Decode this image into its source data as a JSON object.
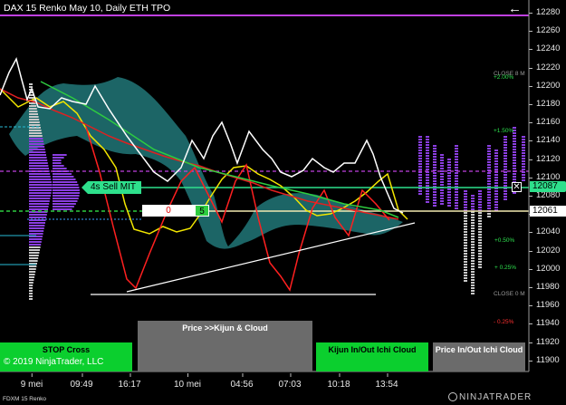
{
  "title": "DAX 15 Renko May 10, Daily ETH TPO",
  "price_axis": [
    "12280",
    "12260",
    "12240",
    "12220",
    "12200",
    "12180",
    "12160",
    "12140",
    "12120",
    "12100",
    "12080",
    "12060",
    "12040",
    "12020",
    "12000",
    "11980",
    "11960",
    "11940",
    "11920",
    "11900"
  ],
  "price_tags": {
    "sell_price": "12087",
    "last_price": "12061"
  },
  "time_axis": [
    "9 mei",
    "09:49",
    "16:17",
    "10 mei",
    "04:56",
    "07:03",
    "10:18",
    "13:54"
  ],
  "pct_levels": [
    {
      "text": "CLOSE 8 M",
      "color": "#9a9a9a"
    },
    {
      "text": "+2.00%",
      "color": "#2ee04e"
    },
    {
      "text": "+1.50%",
      "color": "#2ee04e"
    },
    {
      "text": "+0.50%",
      "color": "#2ee04e"
    },
    {
      "text": "+ 0.25%",
      "color": "#2ee04e"
    },
    {
      "text": "CLOSE 0 M",
      "color": "#9a9a9a"
    },
    {
      "text": "- 0.25%",
      "color": "#ff3030"
    }
  ],
  "order": {
    "label": "4s  Sell MIT",
    "pnl": "0",
    "quantity": "5",
    "close_glyph": "✕"
  },
  "buttons": {
    "stop_cross": "STOP Cross",
    "price_kijun_cloud": "Price >>Kijun & Cloud",
    "kijun_inout": "Kijun In/Out Ichi Cloud",
    "price_inout": "Price In/Out Ichi Cloud"
  },
  "copyright": "© 2019 NinjaTrader, LLC",
  "instrument": "FDXM 15 Renko",
  "brand": "NINJATRADER",
  "colors": {
    "sell_green": "#2ee08c",
    "button_green": "#0bcf2e",
    "button_gray": "#6b6b6b",
    "cloud": "#2a6e70",
    "tpo": "#8a3ee0"
  },
  "icons": {
    "back": "left-arrow-icon",
    "close": "close-icon",
    "brand": "ninjatrader-logo-icon"
  }
}
